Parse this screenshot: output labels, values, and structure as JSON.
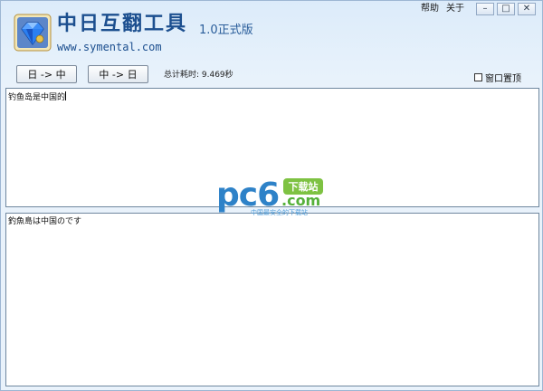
{
  "header": {
    "title": "中日互翻工具",
    "version": "1.0正式版",
    "url": "www.symental.com"
  },
  "top_menu": {
    "help": "帮助",
    "about": "关于"
  },
  "window_controls": {
    "minimize": "–",
    "maximize": "□",
    "close": "✕"
  },
  "toolbar": {
    "ja_to_zh_label": "日 -> 中",
    "zh_to_ja_label": "中 -> 日",
    "elapsed_text": "总计耗时: 9.469秒",
    "always_on_top_label": "窗口置顶",
    "always_on_top_checked": false
  },
  "input_panel": {
    "text": "钓鱼岛是中国的"
  },
  "output_panel": {
    "text": "釣魚島は中国のです"
  },
  "watermark": {
    "brand": "pc6",
    "tag": "下载站",
    "domain": ".com",
    "slogan": "中国最安全的下载站"
  },
  "colors": {
    "title": "#1c4f8f",
    "background": "#e6f1fb",
    "watermark_blue": "#2e82c8",
    "watermark_green": "#7ec242"
  },
  "icons": {
    "logo": "blue-diamond-icon"
  }
}
